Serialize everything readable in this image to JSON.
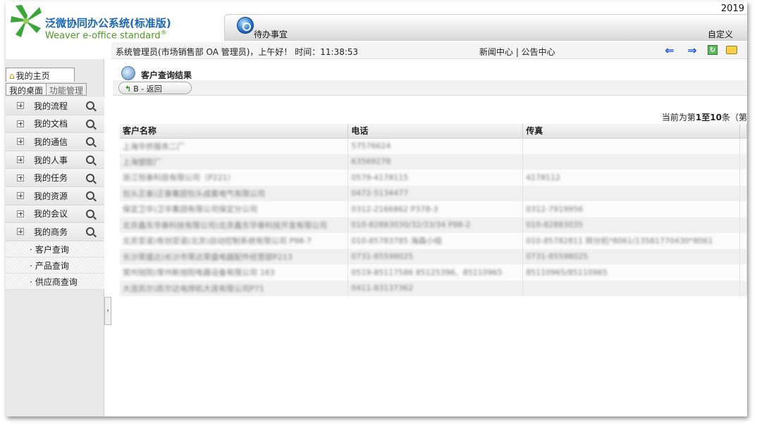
{
  "app": {
    "logo_title": "泛微协同办公系统(标准版)",
    "logo_subtitle": "Weaver e-office standard",
    "logo_reg": "®",
    "year_text": "2019",
    "todo_label": "待办事宜",
    "customize_label": "自定义"
  },
  "status": {
    "greeting": "系统管理员(市场销售部 OA 管理员)，上午好！ 时间：11:38:53",
    "news_links": "新闻中心 | 公告中心",
    "icons": [
      "arrow-left-icon",
      "arrow-right-icon",
      "refresh-icon",
      "folder-icon"
    ]
  },
  "sidebar": {
    "home_label": "我的主页",
    "tab_desk": "我的桌面",
    "tab_func": "功能管理",
    "menu": [
      {
        "label": "我的流程"
      },
      {
        "label": "我的文档"
      },
      {
        "label": "我的通信"
      },
      {
        "label": "我的人事"
      },
      {
        "label": "我的任务"
      },
      {
        "label": "我的资源"
      },
      {
        "label": "我的会议"
      },
      {
        "label": "我的商务"
      }
    ],
    "submenu": [
      {
        "label": "客户查询"
      },
      {
        "label": "产品查询"
      },
      {
        "label": "供应商查询"
      }
    ],
    "collapse_glyph": "‹"
  },
  "main": {
    "title": "客户查询结果",
    "back_button": "B - 返回",
    "page_info_prefix": "当前为第",
    "page_info_range": "1至10",
    "page_info_suffix": "条（第",
    "columns": [
      "客户名称",
      "电话",
      "传真"
    ],
    "rows": [
      {
        "name": "上海华侨服务二厂",
        "phone": "57576624",
        "fax": ""
      },
      {
        "name": "上海塑胶厂",
        "phone": "63569278",
        "fax": ""
      },
      {
        "name": "浙江恒泰科技有限公司（P221）",
        "phone": "0579-4178115",
        "fax": "4178112"
      },
      {
        "name": "包头正泰)正泰集团包头成套电气有限公司",
        "phone": "0472-5134477",
        "fax": ""
      },
      {
        "name": "保定卫华)卫华集团有限公司保定分公司",
        "phone": "0312-2166862 P378-3",
        "fax": "0312-7919956"
      },
      {
        "name": "北京鑫东华泰科技有限公司)北京鑫东华泰科技开发有限公司",
        "phone": "010-82883030/32/33/34 P98-2",
        "fax": "010-82883035"
      },
      {
        "name": "北京亚诺)有创亚诺(北京)自动控制系统有限公司 P98-7",
        "phone": "010-85783785 海森小组",
        "fax": "010-85782811 转分机*8061/13581770430*8061"
      },
      {
        "name": "长沙荣盛达)长沙市荣达荣盛电器配件经营部P213",
        "phone": "0731-85598025",
        "fax": "0731-85598025"
      },
      {
        "name": "常州旭阳)常州新旭阳电器设备有限公司 163",
        "phone": "0519-85117586 85125396、85110965",
        "fax": "85110965/85110965"
      },
      {
        "name": "大连凯尔)凯尔达电焊机大连有限公司P71",
        "phone": "0411-83137362",
        "fax": ""
      }
    ]
  }
}
